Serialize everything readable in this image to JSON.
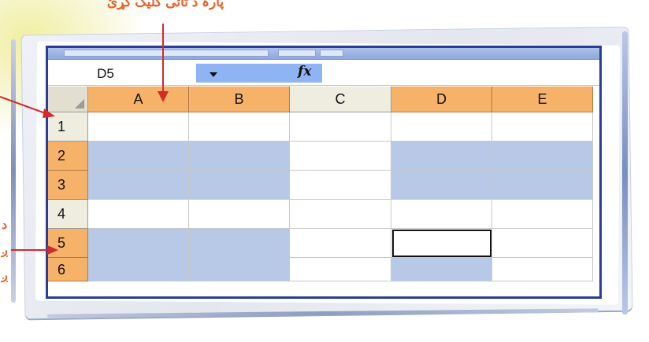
{
  "annotation": {
    "caption": "پارہ د ٹائی کلیک کړئ",
    "side_marks": [
      "د",
      "ږ",
      "ږ"
    ]
  },
  "formula_bar": {
    "name_box": "D5",
    "fx_label": "fx"
  },
  "columns": [
    "A",
    "B",
    "C",
    "D",
    "E"
  ],
  "rows": [
    "1",
    "2",
    "3",
    "4",
    "5",
    "6"
  ],
  "selection": {
    "highlighted_columns": [
      "A",
      "B",
      "D",
      "E"
    ],
    "highlighted_rows": [
      "2",
      "3",
      "5",
      "6"
    ],
    "active_cell": "D5"
  },
  "colors": {
    "header_highlight": "#f7b26a",
    "selection_fill": "#b8c9e8",
    "window_border": "#2b3d97",
    "annotation": "#e8622a",
    "arrow": "#d32a2a"
  }
}
